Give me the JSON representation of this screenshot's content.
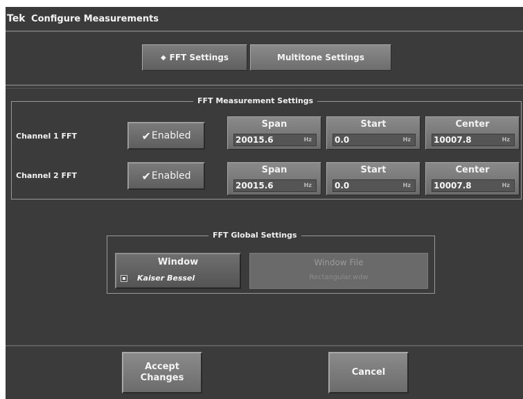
{
  "title": {
    "brand": "Tek",
    "text": "Configure Measurements"
  },
  "tabs": [
    {
      "label": "FFT Settings",
      "mark": "◆",
      "active": true
    },
    {
      "label": "Multitone Settings",
      "active": false
    }
  ],
  "measurement_group": {
    "title": "FFT Measurement Settings",
    "channels": [
      {
        "label": "Channel 1 FFT",
        "toggle": {
          "check": "✔",
          "label": "Enabled"
        },
        "span": {
          "label": "Span",
          "value": "20015.6",
          "unit": "Hz"
        },
        "start": {
          "label": "Start",
          "value": "0.0",
          "unit": "Hz"
        },
        "center": {
          "label": "Center",
          "value": "10007.8",
          "unit": "Hz"
        }
      },
      {
        "label": "Channel 2 FFT",
        "toggle": {
          "check": "✔",
          "label": "Enabled"
        },
        "span": {
          "label": "Span",
          "value": "20015.6",
          "unit": "Hz"
        },
        "start": {
          "label": "Start",
          "value": "0.0",
          "unit": "Hz"
        },
        "center": {
          "label": "Center",
          "value": "10007.8",
          "unit": "Hz"
        }
      }
    ]
  },
  "global_group": {
    "title": "FFT Global Settings",
    "window": {
      "label": "Window",
      "value": "Kaiser Bessel"
    },
    "window_file": {
      "label": "Window File",
      "value": "Rectangular.wdw"
    }
  },
  "actions": {
    "accept": "Accept Changes",
    "cancel": "Cancel"
  },
  "colors": {
    "background": "#3b3b3b",
    "button": "#7a7a7a",
    "text": "#f0f0f0"
  }
}
